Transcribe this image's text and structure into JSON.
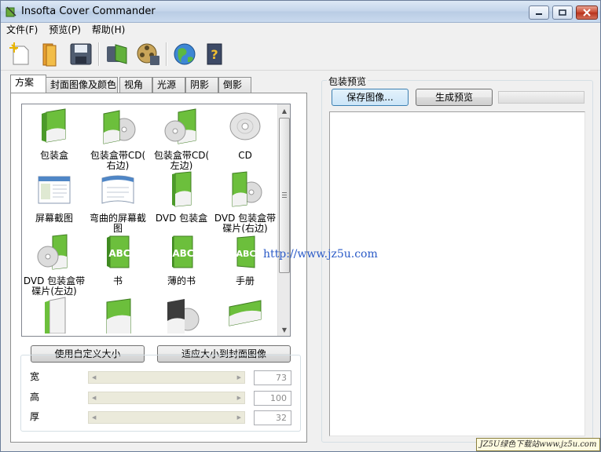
{
  "window": {
    "title": "Insofta Cover Commander"
  },
  "menu": [
    "文件(F)",
    "预览(P)",
    "帮助(H)"
  ],
  "toolbar_icons": [
    "new-project-icon",
    "open-folder-icon",
    "save-disk-icon",
    "save-render-icon",
    "save-film-icon",
    "web-globe-icon",
    "help-book-icon"
  ],
  "tabs": [
    "方案",
    "封面图像及颜色",
    "视角",
    "光源",
    "阴影",
    "倒影"
  ],
  "schemes": [
    [
      "包装盒"
    ],
    [
      "包装盒带CD(",
      "右边)"
    ],
    [
      "包装盒带CD(",
      "左边)"
    ],
    [
      "CD"
    ],
    [
      "屏幕截图"
    ],
    [
      "弯曲的屏幕截",
      "图"
    ],
    [
      "DVD 包装盒"
    ],
    [
      "DVD 包装盒带",
      "碟片(右边)"
    ],
    [
      "DVD 包装盒带",
      "碟片(左边)"
    ],
    [
      "书"
    ],
    [
      "薄的书"
    ],
    [
      "手册"
    ]
  ],
  "size_buttons": {
    "custom": "使用自定义大小",
    "fit": "适应大小到封面图像"
  },
  "dimensions": [
    {
      "label": "宽",
      "value": "73"
    },
    {
      "label": "高",
      "value": "100"
    },
    {
      "label": "厚",
      "value": "32"
    }
  ],
  "preview": {
    "group_title": "包装预览",
    "save_button": "保存图像...",
    "generate_button": "生成预览"
  },
  "watermark": {
    "url": "http://www.jz5u.com",
    "badge": "JZ5U绿色下载站www.jz5u.com"
  }
}
